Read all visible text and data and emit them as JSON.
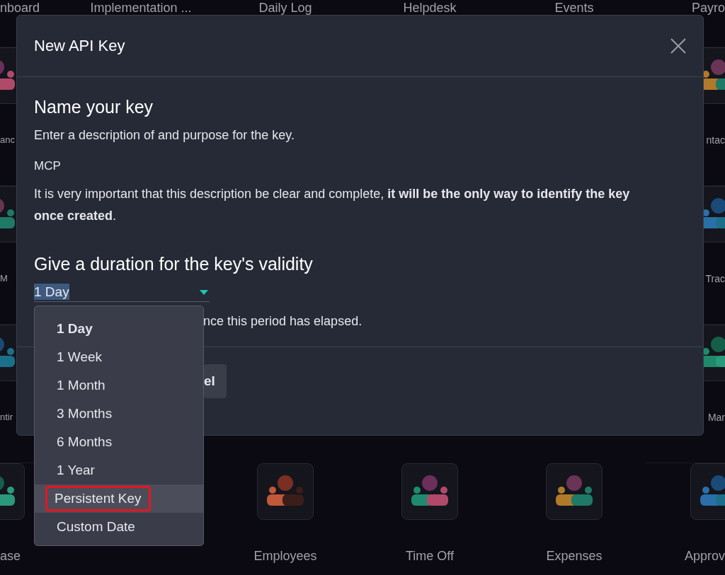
{
  "app_grid": {
    "rows": [
      {
        "items": [
          {
            "label": "nboard"
          },
          {
            "label": "Implementation ..."
          },
          {
            "label": "Daily Log"
          },
          {
            "label": "Helpdesk"
          },
          {
            "label": "Events"
          },
          {
            "label": "Payro"
          }
        ]
      },
      {
        "items": [
          {
            "label": "anc"
          },
          {
            "label": "ntac"
          }
        ]
      },
      {
        "items": [
          {
            "label": "M"
          },
          {
            "label": "Trac"
          }
        ]
      },
      {
        "items": [
          {
            "label": "ntir"
          },
          {
            "label": "Mar"
          }
        ]
      },
      {
        "items": [
          {
            "label": "ase"
          },
          {
            "label": "Employees"
          },
          {
            "label": "Time Off"
          },
          {
            "label": "Expenses"
          },
          {
            "label": "Approv"
          }
        ]
      }
    ]
  },
  "dialog": {
    "title": "New API Key",
    "name_section": {
      "heading": "Name your key",
      "description": "Enter a description of and purpose for the key.",
      "value": "MCP",
      "note": "It is very important that this description be clear and complete, **it will be the only way to identify the key once created**."
    },
    "duration_section": {
      "heading": "Give a duration for the key's validity",
      "value": "1 Day",
      "hint": "nce this period has elapsed.",
      "options": [
        {
          "label": "1 Day",
          "selected": true,
          "hovered": false,
          "annotated": false
        },
        {
          "label": "1 Week",
          "selected": false,
          "hovered": false,
          "annotated": false
        },
        {
          "label": "1 Month",
          "selected": false,
          "hovered": false,
          "annotated": false
        },
        {
          "label": "3 Months",
          "selected": false,
          "hovered": false,
          "annotated": false
        },
        {
          "label": "6 Months",
          "selected": false,
          "hovered": false,
          "annotated": false
        },
        {
          "label": "1 Year",
          "selected": false,
          "hovered": false,
          "annotated": false
        },
        {
          "label": "Persistent Key",
          "selected": false,
          "hovered": true,
          "annotated": true
        },
        {
          "label": "Custom Date",
          "selected": false,
          "hovered": false,
          "annotated": false
        }
      ]
    },
    "buttons": [
      {
        "label": "el"
      }
    ]
  }
}
